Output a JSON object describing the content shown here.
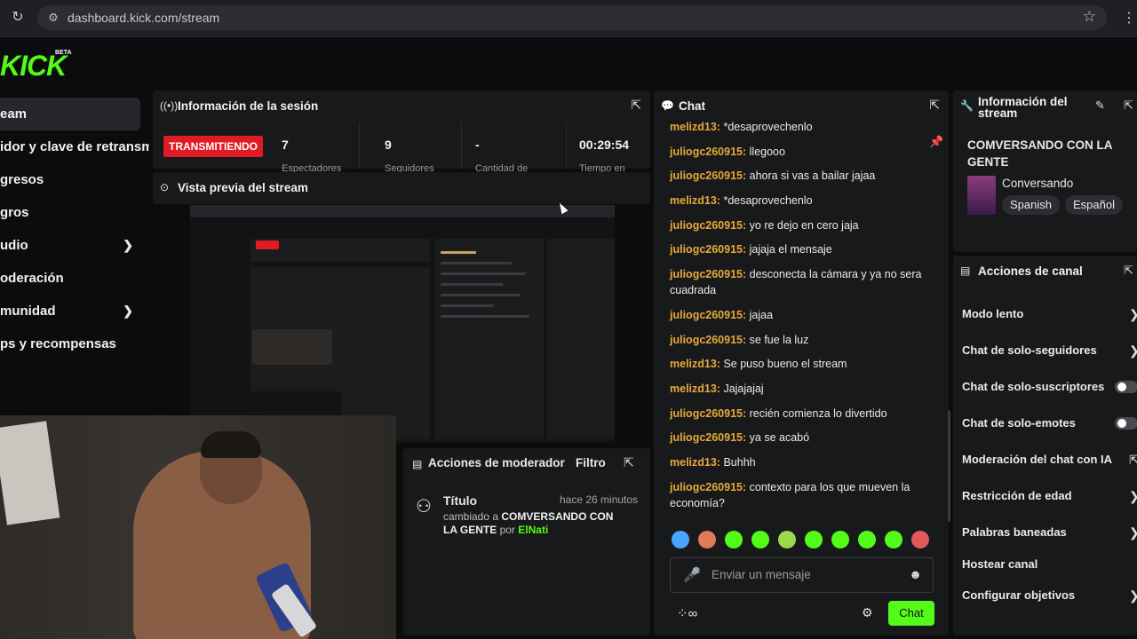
{
  "browser": {
    "url": "dashboard.kick.com/stream"
  },
  "app": {
    "logo": "KICK",
    "logo_badge": "BETA"
  },
  "sidebar": {
    "items": [
      {
        "label": "eam",
        "active": true,
        "expandable": false
      },
      {
        "label": "idor y clave de retransmisión",
        "active": false,
        "expandable": false
      },
      {
        "label": "gresos",
        "active": false,
        "expandable": false
      },
      {
        "label": "gros",
        "active": false,
        "expandable": false
      },
      {
        "label": "udio",
        "active": false,
        "expandable": true
      },
      {
        "label": "oderación",
        "active": false,
        "expandable": false
      },
      {
        "label": "munidad",
        "active": false,
        "expandable": true
      },
      {
        "label": "ps y recompensas",
        "active": false,
        "expandable": false
      }
    ]
  },
  "session": {
    "title": "Información de la sesión",
    "status": "TRANSMITIENDO",
    "stats": [
      {
        "value": "7",
        "label": "Espectadores"
      },
      {
        "value": "9",
        "label": "Seguidores"
      },
      {
        "value": "-",
        "label": "Cantidad de"
      },
      {
        "value": "00:29:54",
        "label": "Tiempo en"
      }
    ]
  },
  "preview": {
    "title": "Vista previa del stream"
  },
  "mod_actions": {
    "title": "Acciones de moderador",
    "filter": "Filtro",
    "entry": {
      "name": "Título",
      "time": "hace 26 minutos",
      "desc_prefix": "cambiado a",
      "desc_value": "COMVERSANDO CON LA GENTE",
      "desc_by": "por",
      "desc_user": "ElNati"
    }
  },
  "chat": {
    "title": "Chat",
    "input_placeholder": "Enviar un mensaje",
    "send_label": "Chat",
    "messages": [
      {
        "user": "melizd13:",
        "text": "*desaprovechenlo",
        "color": "#e9a83b"
      },
      {
        "user": "juliogc260915:",
        "text": "llegooo",
        "color": "#e9a83b"
      },
      {
        "user": "juliogc260915:",
        "text": "ahora si vas a bailar jajaa",
        "color": "#e9a83b"
      },
      {
        "user": "melizd13:",
        "text": "*desaprovechenlo",
        "color": "#e9a83b"
      },
      {
        "user": "juliogc260915:",
        "text": "yo re dejo en cero jaja",
        "color": "#e9a83b"
      },
      {
        "user": "juliogc260915:",
        "text": "jajaja el mensaje",
        "color": "#e9a83b"
      },
      {
        "user": "juliogc260915:",
        "text": "desconecta la cámara y ya no sera cuadrada",
        "color": "#e9a83b"
      },
      {
        "user": "juliogc260915:",
        "text": "jajaa",
        "color": "#e9a83b"
      },
      {
        "user": "juliogc260915:",
        "text": "se fue la luz",
        "color": "#e9a83b"
      },
      {
        "user": "melizd13:",
        "text": "Se puso bueno el stream",
        "color": "#e9a83b"
      },
      {
        "user": "melizd13:",
        "text": "Jajajajaj",
        "color": "#e9a83b"
      },
      {
        "user": "juliogc260915:",
        "text": "recién comienza lo divertido",
        "color": "#e9a83b"
      },
      {
        "user": "juliogc260915:",
        "text": "ya se acabó",
        "color": "#e9a83b"
      },
      {
        "user": "melizd13:",
        "text": "Buhhh",
        "color": "#e9a83b"
      },
      {
        "user": "juliogc260915:",
        "text": "contexto para los que mueven la economía?",
        "color": "#e9a83b"
      }
    ],
    "emote_colors": [
      "#4aa3ff",
      "#e07a5a",
      "#53fc18",
      "#53fc18",
      "#9ad94a",
      "#53fc18",
      "#53fc18",
      "#53fc18",
      "#53fc18",
      "#e05a5a"
    ]
  },
  "stream_info": {
    "title": "Información del stream",
    "stream_title": "COMVERSANDO CON LA GENTE",
    "category": "Conversando",
    "tags": [
      "Spanish",
      "Español"
    ]
  },
  "channel_actions": {
    "title": "Acciones de canal",
    "items": [
      {
        "label": "Modo lento",
        "control": "chevron"
      },
      {
        "label": "Chat de solo-seguidores",
        "control": "chevron"
      },
      {
        "label": "Chat de solo-suscriptores",
        "control": "toggle"
      },
      {
        "label": "Chat de solo-emotes",
        "control": "toggle"
      },
      {
        "label": "Moderación del chat con IA",
        "control": "external"
      },
      {
        "label": "Restricción de edad",
        "control": "chevron"
      },
      {
        "label": "Palabras baneadas",
        "control": "chevron"
      },
      {
        "label": "Hostear canal",
        "control": "none"
      },
      {
        "label": "Configurar objetivos",
        "control": "chevron"
      }
    ]
  },
  "colors": {
    "brand": "#53fc18",
    "live": "#e01b24",
    "username": "#e9a83b"
  }
}
